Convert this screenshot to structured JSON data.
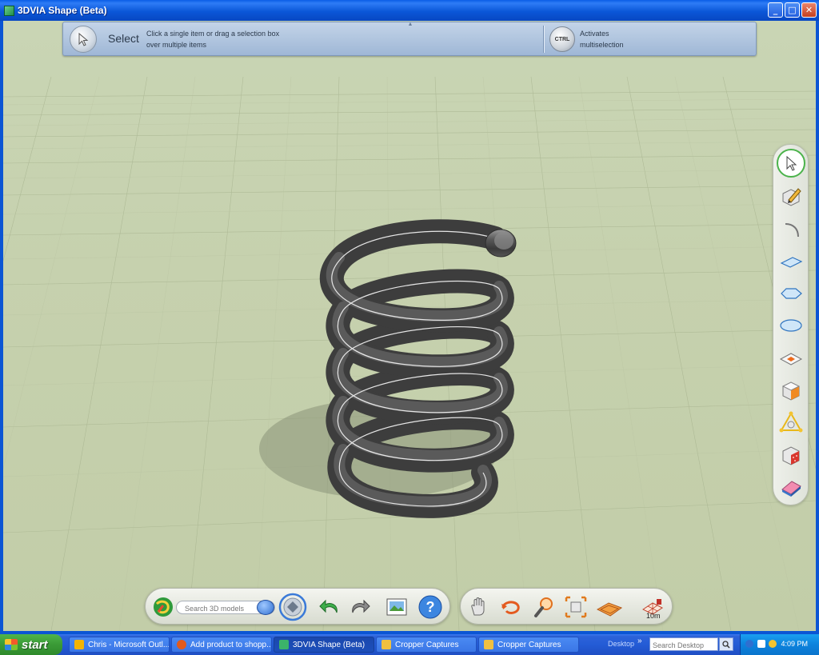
{
  "window": {
    "title": "3DVIA Shape (Beta)",
    "controls": {
      "minimize": "_",
      "maximize": "□",
      "close": "✕"
    }
  },
  "hint_panel": {
    "tool_name": "Select",
    "tool_description_line1": "Click a single item or drag a selection box",
    "tool_description_line2": "over multiple items",
    "collapse_glyph": "▲",
    "ctrl_key_label": "CTRL",
    "ctrl_description_line1": "Activates",
    "ctrl_description_line2": "multiselection"
  },
  "right_toolbar": {
    "tools": [
      {
        "name": "select-tool",
        "icon": "select-arrow-icon",
        "active": true
      },
      {
        "name": "draw-tool",
        "icon": "pencil-cube-icon"
      },
      {
        "name": "arc-tool",
        "icon": "arc-icon"
      },
      {
        "name": "rectangle-tool",
        "icon": "rectangle-icon"
      },
      {
        "name": "polygon-tool",
        "icon": "polygon-icon"
      },
      {
        "name": "ellipse-tool",
        "icon": "ellipse-icon"
      },
      {
        "name": "paint-face-tool",
        "icon": "paint-face-icon"
      },
      {
        "name": "push-pull-tool",
        "icon": "push-pull-icon"
      },
      {
        "name": "move-tool",
        "icon": "move-icon"
      },
      {
        "name": "material-tool",
        "icon": "material-icon"
      },
      {
        "name": "eraser-tool",
        "icon": "eraser-icon"
      }
    ]
  },
  "bottom_toolbar": {
    "search_placeholder": "Search 3D models",
    "scale_label": "10m"
  },
  "taskbar": {
    "start_label": "start",
    "items": [
      {
        "label": "Chris - Microsoft Outl...",
        "color": "#f4b400"
      },
      {
        "label": "Add product to shopp...",
        "color": "#e25a1c"
      },
      {
        "label": "3DVIA Shape (Beta)",
        "color": "#3bb36a",
        "active": true
      },
      {
        "label": "Cropper Captures",
        "color": "#f0c040"
      },
      {
        "label": "Cropper Captures",
        "color": "#f0c040"
      }
    ],
    "desktop_label": "Desktop",
    "chevron": "»",
    "desktop_search_placeholder": "Search Desktop",
    "clock": "4:09 PM"
  }
}
